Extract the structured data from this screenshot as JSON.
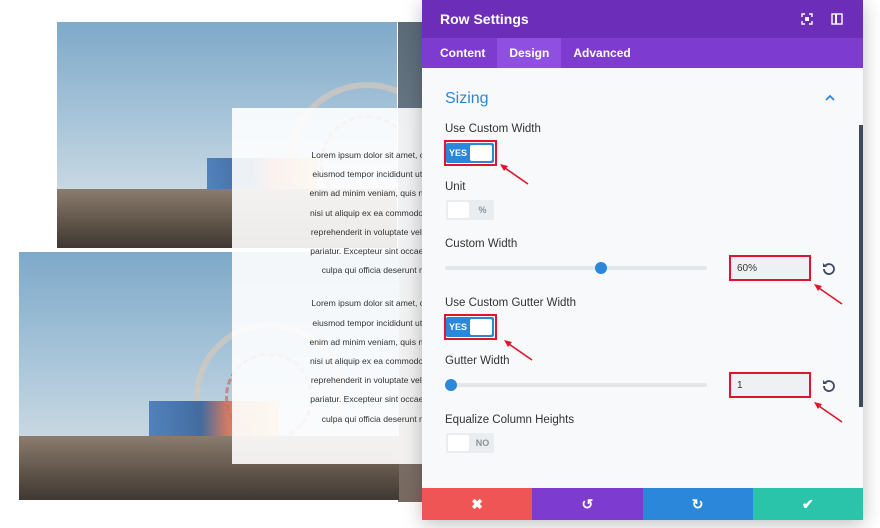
{
  "background": {
    "paragraphs": [
      [
        "Lorem ipsum dolor sit amet, consectet",
        "eiusmod tempor incididunt ut labore e",
        "enim ad minim veniam, quis nostrud ex",
        "nisi ut aliquip ex ea commodo consequ",
        "reprehenderit in voluptate velit esse cil",
        "pariatur. Excepteur sint occaecat cupid",
        "culpa qui officia deserunt mollit a"
      ],
      [
        "Lorem ipsum dolor sit amet, consectet",
        "eiusmod tempor incididunt ut labore e",
        "enim ad minim veniam, quis nostrud ex",
        "nisi ut aliquip ex ea commodo consequ",
        "reprehenderit in voluptate velit esse cil",
        "pariatur. Excepteur sint occaecat cupid",
        "culpa qui officia deserunt mollit a"
      ]
    ]
  },
  "panel": {
    "title": "Row Settings",
    "header_icons": [
      "expand-icon",
      "sidebar-icon"
    ],
    "tabs": [
      "Content",
      "Design",
      "Advanced"
    ],
    "active_tab": "Design",
    "section": {
      "title": "Sizing",
      "collapse_icon": "chevron-up-icon"
    },
    "fields": {
      "custom_width_toggle": {
        "label": "Use Custom Width",
        "state": "YES"
      },
      "unit": {
        "label": "Unit",
        "value": "%"
      },
      "custom_width": {
        "label": "Custom Width",
        "value": "60%",
        "slider_fraction": 0.6
      },
      "custom_gutter_toggle": {
        "label": "Use Custom Gutter Width",
        "state": "YES"
      },
      "gutter_width": {
        "label": "Gutter Width",
        "value": "1",
        "slider_fraction": 0.0
      },
      "equalize": {
        "label": "Equalize Column Heights",
        "state": "NO"
      }
    },
    "footer": {
      "buttons": [
        {
          "name": "cancel",
          "icon": "close-icon",
          "glyph": "✖",
          "color": "#ef5555"
        },
        {
          "name": "undo",
          "icon": "undo-icon",
          "glyph": "↺",
          "color": "#7e3bd0"
        },
        {
          "name": "redo",
          "icon": "redo-icon",
          "glyph": "↻",
          "color": "#2b87da"
        },
        {
          "name": "save",
          "icon": "check-icon",
          "glyph": "✔",
          "color": "#29c4a9"
        }
      ]
    }
  },
  "colors": {
    "header": "#6c2eb9",
    "tabs": "#7e3bd0",
    "accent": "#2b87da",
    "highlight": "#e0152b"
  }
}
